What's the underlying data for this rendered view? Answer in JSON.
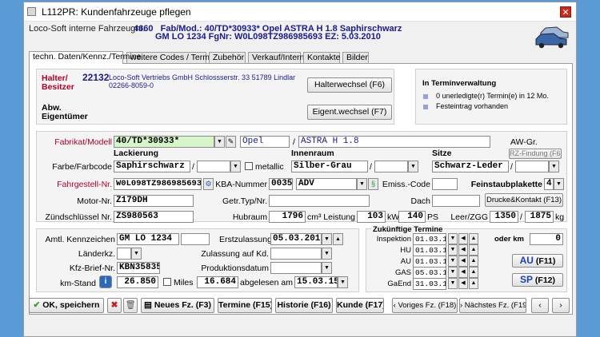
{
  "window": {
    "title": "L112PR: Kundenfahrzeuge pflegen",
    "close_glyph": "✕"
  },
  "header": {
    "label": "Loco-Soft interne Fahrzeugnr.",
    "vehicle_no": "4660",
    "line1": "Fab/Mod.: 40/TD*30933*  Opel  ASTRA H 1.8  Saphirschwarz",
    "line2": "GM LO 1234    FgNr: W0L098TZ986985693  EZ: 5.03.2010"
  },
  "tabs": [
    "techn. Daten/Kennz./Termine",
    "weitere Codes / Termine",
    "Zubehör",
    "Verkauf/Interna",
    "Kontakte",
    "Bilder"
  ],
  "owner": {
    "label_halter": "Halter/",
    "label_besitzer": "Besitzer",
    "number": "22132",
    "name_line1": "Loco-Soft Vertriebs GmbH Schlossserstr. 33 51789 Lindlar",
    "name_line2": "02266-8059-0",
    "abw_label": "Abw.",
    "eigentuemer_label": "Eigentümer",
    "halterwechsel_button": "Halterwechsel (F6)",
    "eigentwechsel_button": "Eigent.wechsel (F7)"
  },
  "terminverwaltung": {
    "title": "In Terminverwaltung",
    "item1": "0  unerledigte(r) Termin(e) in 12 Mo.",
    "item2": "Festeintrag vorhanden"
  },
  "vehicle": {
    "fabrikat_label": "Fabrikat/Modell",
    "fabrikat_value": "40/TD*30933*",
    "make_value": "Opel",
    "slash": "/",
    "model_value": "ASTRA H 1.8",
    "awgr_label": "AW-Gr.",
    "rz_button": "RZ-Findung (F6)",
    "lackierung_label": "Lackierung",
    "innenraum_label": "Innenraum",
    "sitze_label": "Sitze",
    "farbe_label": "Farbe/Farbcode",
    "farbe_value": "Saphirschwarz",
    "metallic_label": "metallic",
    "innenraum_value": "Silber-Grau",
    "sitze_value": "Schwarz-Leder",
    "fgnr_label": "Fahrgestell-Nr.",
    "fgnr_value": "W0L098TZ986985693",
    "kba_label": "KBA-Nummer",
    "kba_value1": "0035",
    "kba_value2": "ADV",
    "emiss_label": "Emiss.-Code",
    "feinstaub_label": "Feinstaubplakette",
    "feinstaub_value": "4",
    "motor_label": "Motor-Nr.",
    "motor_value": "Z179DH",
    "getr_label": "Getr.Typ/Nr.",
    "dach_label": "Dach",
    "drucke_button": "Drucke&Kontakt (F13)",
    "zuend_label": "Zündschlüssel Nr.",
    "zuend_value": "ZS980563",
    "hubraum_label": "Hubraum",
    "hubraum_value": "1796",
    "hubraum_unit": "cm³",
    "leistung_label": "Leistung",
    "leistung_kw": "103",
    "kw_unit": "kW",
    "leistung_ps": "140",
    "ps_unit": "PS",
    "leer_label": "Leer/ZGG",
    "leer_value": "1350",
    "zgg_value": "1875",
    "kg_unit": "kg"
  },
  "registration": {
    "kennz_label": "Amtl. Kennzeichen",
    "kennz_value": "GM LO 1234",
    "erstzul_label": "Erstzulassung",
    "erstzul_value": "05.03.2010",
    "laenderkz_label": "Länderkz.",
    "zul_kd_label": "Zulassung auf Kd.",
    "kfzbrief_label": "Kfz-Brief-Nr.",
    "kfzbrief_value": "KBN35835",
    "produktion_label": "Produktionsdatum",
    "kmstand_label": "km-Stand",
    "kmstand_value": "26.850",
    "miles_label": "Miles",
    "miles_value": "16.684",
    "abgelesen_label": "abgelesen am",
    "abgelesen_value": "15.03.15"
  },
  "termine": {
    "title": "Zukünftige Termine",
    "rows": [
      {
        "label": "Inspektion",
        "date": "01.03.17"
      },
      {
        "label": "HU",
        "date": "01.03.17"
      },
      {
        "label": "AU",
        "date": "01.03.17"
      },
      {
        "label": "GAS",
        "date": "05.03.11"
      },
      {
        "label": "GaEnd",
        "date": "31.03.12"
      }
    ],
    "oder_km_label": "oder km",
    "oder_km_value": "0",
    "au_button": "AU",
    "au_key": "(F11)",
    "sp_button": "SP",
    "sp_key": "(F12)"
  },
  "bottom": {
    "ok_label": "OK, speichern",
    "neues_label": "Neues Fz. (F3)",
    "termine_label": "Termine (F15)",
    "historie_label": "Historie (F16)",
    "kunde_label": "Kunde (F17)",
    "voriges_label": "‹ Voriges Fz. (F18)",
    "naechstes_label": "› Nächstes Fz. (F19)"
  },
  "colors": {
    "accent_blue": "#1a1a8c",
    "label_red": "#b0002a",
    "desktop": "#5b9bd5"
  }
}
